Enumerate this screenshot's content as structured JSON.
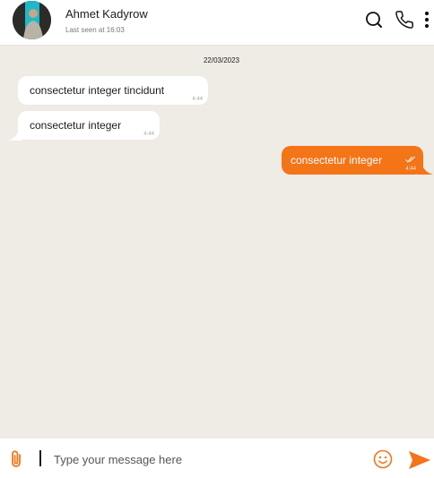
{
  "contact": {
    "name": "Ahmet Kadyrow",
    "status": "Last seen at 16:03"
  },
  "header_icons": [
    "search-icon",
    "phone-icon",
    "more-vertical-icon"
  ],
  "chat": {
    "date": "22/03/2023",
    "messages": [
      {
        "direction": "incoming",
        "text": "consectetur integer tincidunt",
        "time": "4:44"
      },
      {
        "direction": "incoming",
        "text": "consectetur integer",
        "time": "4:44"
      },
      {
        "direction": "outgoing",
        "text": "consectetur integer",
        "time": "4:44",
        "read": true
      }
    ]
  },
  "composer": {
    "placeholder": "Type your message here",
    "value": "",
    "icons": [
      "paperclip-icon",
      "emoji-icon",
      "send-icon"
    ]
  },
  "colors": {
    "accent": "#f47418",
    "chat_background": "#efebe5",
    "bubble_incoming": "#ffffff"
  }
}
